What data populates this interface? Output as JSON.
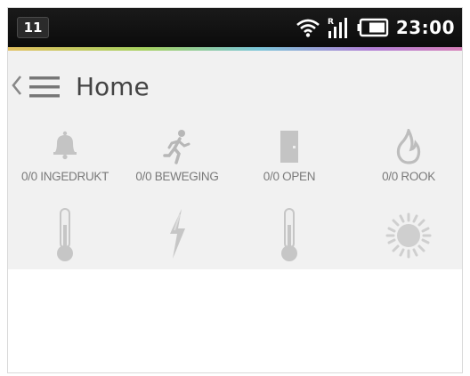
{
  "status_bar": {
    "notification": "11",
    "time": "23:00",
    "icons": [
      "wifi-icon",
      "signal-icon",
      "battery-icon"
    ]
  },
  "action_bar": {
    "title": "Home",
    "icons": [
      "back-caret-icon",
      "menu-icon"
    ]
  },
  "sensors": [
    {
      "icon": "bell-icon",
      "label": "0/0 INGEDRUKT"
    },
    {
      "icon": "running-person-icon",
      "label": "0/0 BEWEGING"
    },
    {
      "icon": "door-icon",
      "label": "0/0 OPEN"
    },
    {
      "icon": "flame-icon",
      "label": "0/0 ROOK"
    }
  ],
  "indicators": [
    {
      "icon": "thermometer-icon"
    },
    {
      "icon": "lightning-icon"
    },
    {
      "icon": "thermometer-icon"
    },
    {
      "icon": "sun-icon"
    }
  ],
  "colors": {
    "status_bar": "#111111",
    "action_bar": "#f1f1f1",
    "icon_gray": "#bdbdbd",
    "label_gray": "#7a7a7a"
  }
}
